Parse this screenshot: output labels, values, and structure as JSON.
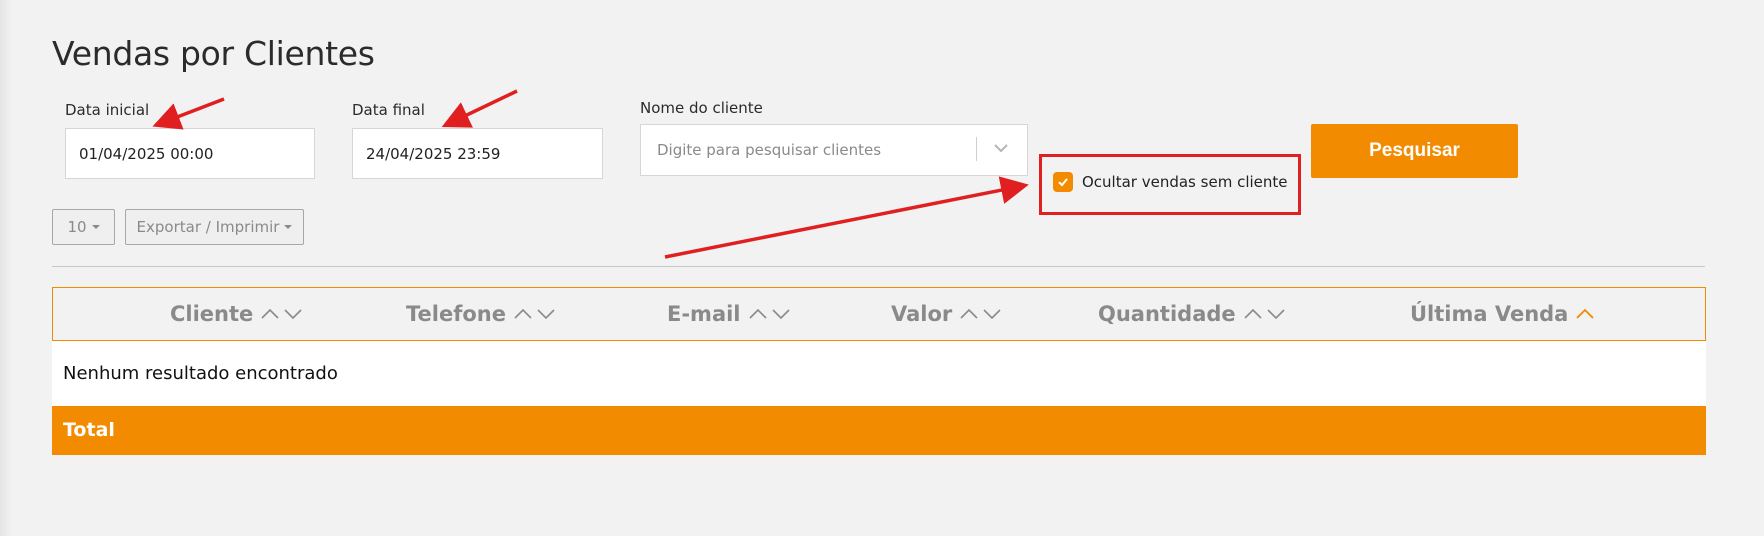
{
  "page": {
    "title": "Vendas por Clientes"
  },
  "filters": {
    "start_date": {
      "label": "Data inicial",
      "value": "01/04/2025 00:00"
    },
    "end_date": {
      "label": "Data final",
      "value": "24/04/2025 23:59"
    },
    "client": {
      "label": "Nome do cliente",
      "placeholder": "Digite para pesquisar clientes"
    },
    "hide_no_client": {
      "label": "Ocultar vendas sem cliente",
      "checked": true
    },
    "search_button": "Pesquisar"
  },
  "toolbar": {
    "page_size": "10",
    "export_label": "Exportar / Imprimir"
  },
  "table": {
    "columns": [
      "Cliente",
      "Telefone",
      "E-mail",
      "Valor",
      "Quantidade",
      "Última Venda"
    ],
    "active_sort": {
      "column": "Última Venda",
      "direction": "asc"
    },
    "empty_message": "Nenhum resultado encontrado",
    "total_label": "Total"
  },
  "colors": {
    "accent": "#f28b00",
    "annotation": "#e02020",
    "header_text": "#8a8a8a"
  },
  "icons": {
    "sort": "sort-arrows-icon",
    "dropdown": "chevron-down-icon",
    "check": "check-icon"
  }
}
